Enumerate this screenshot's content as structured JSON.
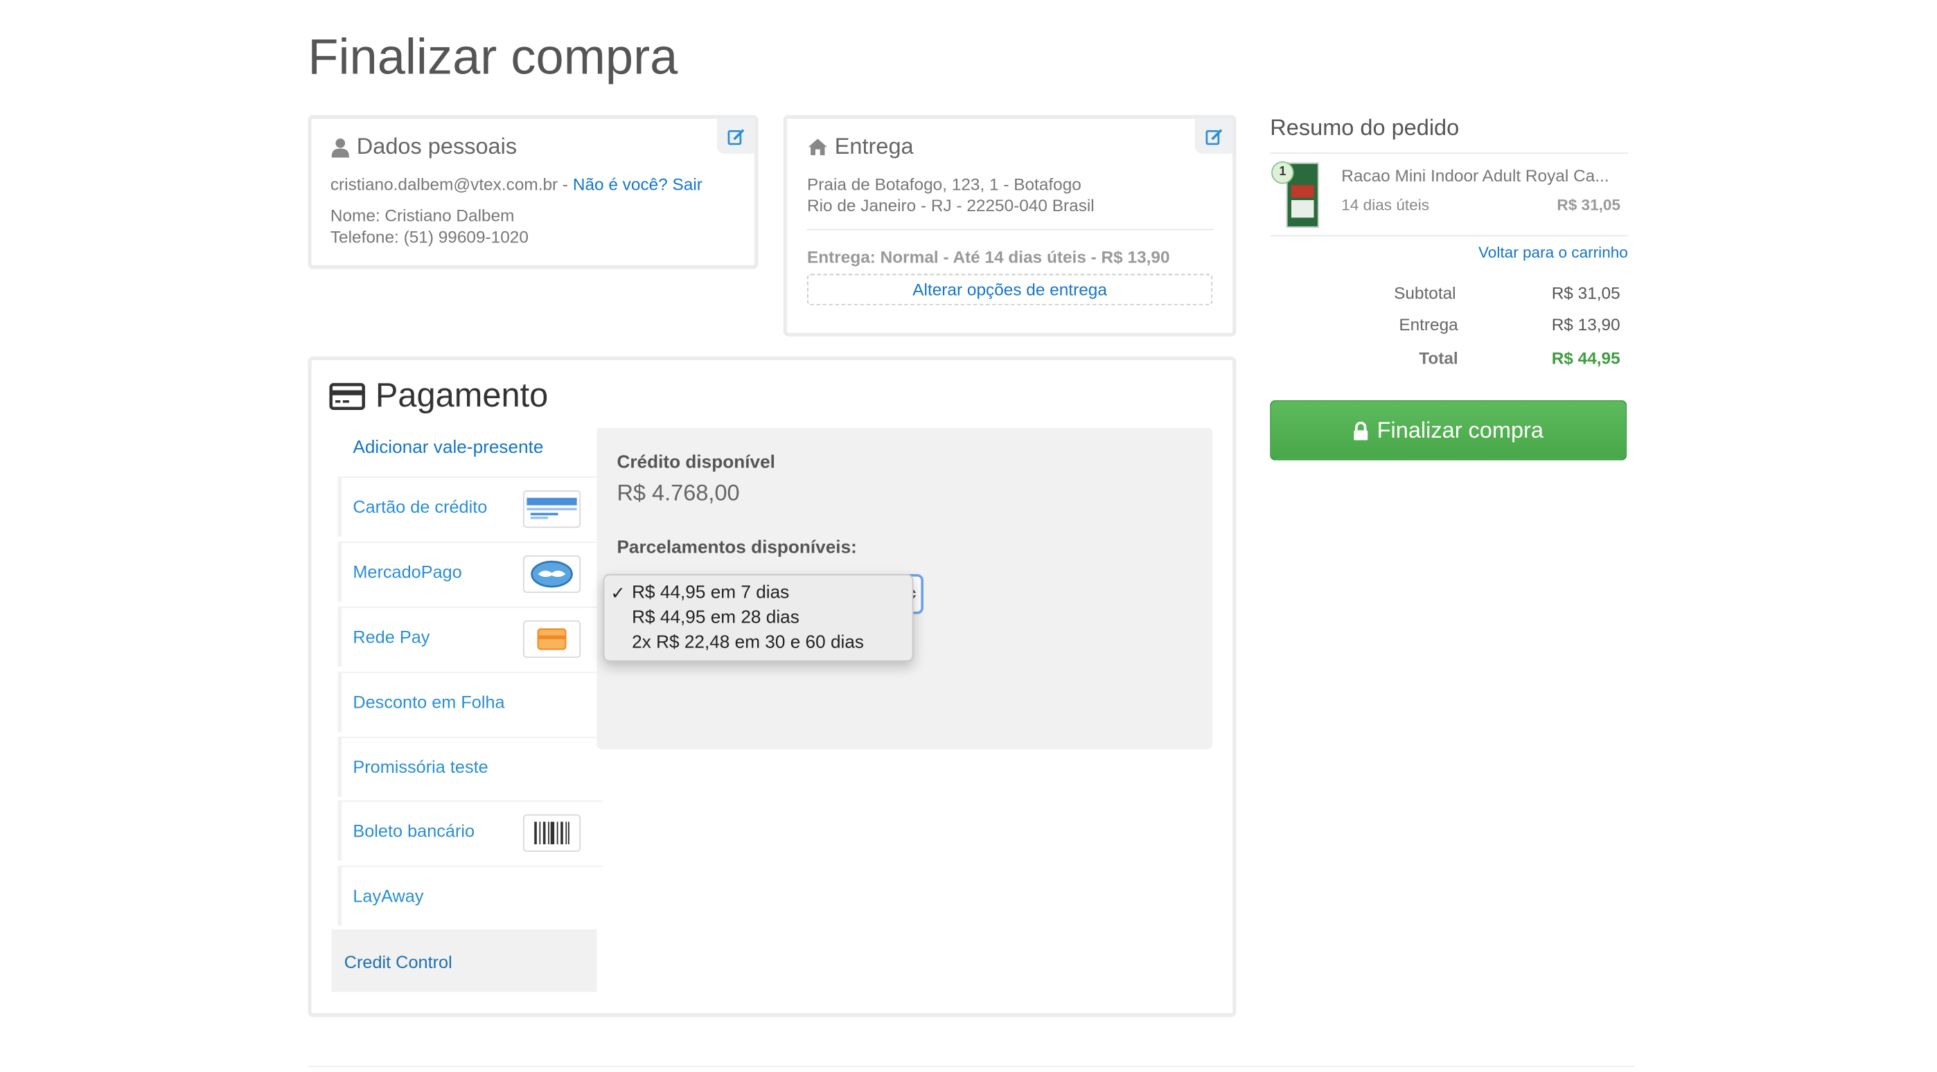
{
  "page": {
    "title": "Finalizar compra"
  },
  "personal": {
    "title": "Dados pessoais",
    "email": "cristiano.dalbem@vtex.com.br -",
    "not_you_link": "Não é você? Sair",
    "name": "Nome: Cristiano Dalbem",
    "phone": "Telefone: (51) 99609-1020",
    "icon": "user-icon"
  },
  "shipping": {
    "title": "Entrega",
    "address_line1": "Praia de Botafogo, 123, 1 - Botafogo",
    "address_line2": "Rio de Janeiro - RJ - 22250-040 Brasil",
    "delivery": "Entrega: Normal - Até 14 dias úteis - R$ 13,90",
    "change_button": "Alterar opções de entrega",
    "icon": "home-icon"
  },
  "summary": {
    "title": "Resumo do pedido",
    "item": {
      "quantity": "1",
      "name": "Racao Mini Indoor Adult Royal Ca...",
      "delivery_time": "14 dias úteis",
      "price": "R$ 31,05"
    },
    "back_link": "Voltar para o carrinho",
    "rows": [
      {
        "label": "Subtotal",
        "value": "R$ 31,05"
      },
      {
        "label": "Entrega",
        "value": "R$ 13,90"
      },
      {
        "label": "Total",
        "value": "R$ 44,95"
      }
    ],
    "finalize_button": "Finalizar compra",
    "accent_color": "#4cae4c"
  },
  "payment": {
    "title": "Pagamento",
    "gift_card_link": "Adicionar vale-presente",
    "methods": [
      {
        "label": "Cartão de crédito",
        "icon": "credit-card-icon"
      },
      {
        "label": "MercadoPago",
        "icon": "handshake-icon"
      },
      {
        "label": "Rede Pay",
        "icon": "card-icon"
      },
      {
        "label": "Desconto em Folha",
        "icon": ""
      },
      {
        "label": "Promissória teste",
        "icon": ""
      },
      {
        "label": "Boleto bancário",
        "icon": "barcode-icon"
      },
      {
        "label": "LayAway",
        "icon": ""
      },
      {
        "label": "Credit Control",
        "icon": "",
        "selected": true
      }
    ],
    "panel": {
      "credit_label": "Crédito disponível",
      "credit_value": "R$ 4.768,00",
      "installments_label": "Parcelamentos disponíveis:",
      "options": [
        "R$ 44,95 em 7 dias",
        "R$ 44,95 em 28 dias",
        "2x R$ 22,48 em 30 e 60 dias"
      ],
      "selected_mark": "✓"
    }
  }
}
